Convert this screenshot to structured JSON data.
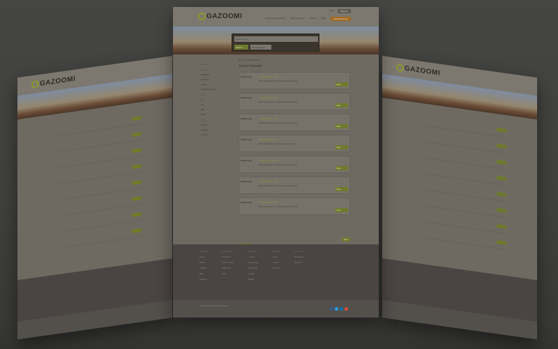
{
  "brand": {
    "name": "GAZOOMI"
  },
  "header": {
    "toplinks": [
      "Login",
      "Register"
    ],
    "nav": [
      "Advertise Experience",
      "About Gazoomi",
      "Contact",
      "Blog"
    ],
    "nav_cta": "Add Experience"
  },
  "search": {
    "placeholder": "Search here",
    "button": "Search",
    "select": "All Categories"
  },
  "filters": {
    "heading": "Filter By",
    "groups": [
      {
        "title": "Country",
        "items": [
          "England",
          "Scotland",
          "Wales",
          "Northern Ireland"
        ]
      },
      {
        "title": "Price",
        "items": [
          "£",
          "££",
          "£££",
          "££££"
        ]
      },
      {
        "title": "Rating",
        "items": [
          "5 Stars",
          "4 Stars",
          "3 Stars"
        ]
      }
    ]
  },
  "results": {
    "breadcrumb": "Home / Search Results",
    "title": "Search Results",
    "cards": [
      {
        "thumb": "brand logo",
        "title": "Experience title",
        "desc": "Short description of the experience listing",
        "view": "View"
      },
      {
        "thumb": "brand logo",
        "title": "Experience title",
        "desc": "Short description of the experience listing",
        "view": "View"
      },
      {
        "thumb": "brand logo",
        "title": "Experience title",
        "desc": "Short description of the experience listing",
        "view": "View"
      },
      {
        "thumb": "brand logo",
        "title": "Experience title",
        "desc": "Short description of the experience listing",
        "view": "View"
      },
      {
        "thumb": "brand logo",
        "title": "Experience title",
        "desc": "Short description of the experience listing",
        "view": "View"
      },
      {
        "thumb": "brand logo",
        "title": "Experience title",
        "desc": "Short description of the experience listing",
        "view": "View"
      },
      {
        "thumb": "brand logo",
        "title": "Experience title",
        "desc": "Short description of the experience listing",
        "view": "View"
      }
    ],
    "prev": "Previous",
    "next": "Next"
  },
  "footer": {
    "columns": [
      {
        "heading": "Gazoomi",
        "links": [
          "Home",
          "About",
          "Contact",
          "Blog",
          "Careers"
        ]
      },
      {
        "heading": "Experiences",
        "links": [
          "Adventure",
          "Food & Drink",
          "Days Out",
          "Gifts"
        ]
      },
      {
        "heading": "Locations",
        "links": [
          "London",
          "Manchester",
          "Edinburgh",
          "Cardiff",
          "Belfast"
        ]
      },
      {
        "heading": "Support",
        "links": [
          "Help",
          "Terms",
          "Privacy"
        ]
      },
      {
        "heading": "Follow Us",
        "links": [
          "Newsletter",
          "Partners"
        ]
      }
    ],
    "copyright": "© Gazoomi. All rights reserved.",
    "social_colors": [
      "#3b5998",
      "#1da1f2",
      "#0e76a8",
      "#dd4b39"
    ]
  }
}
